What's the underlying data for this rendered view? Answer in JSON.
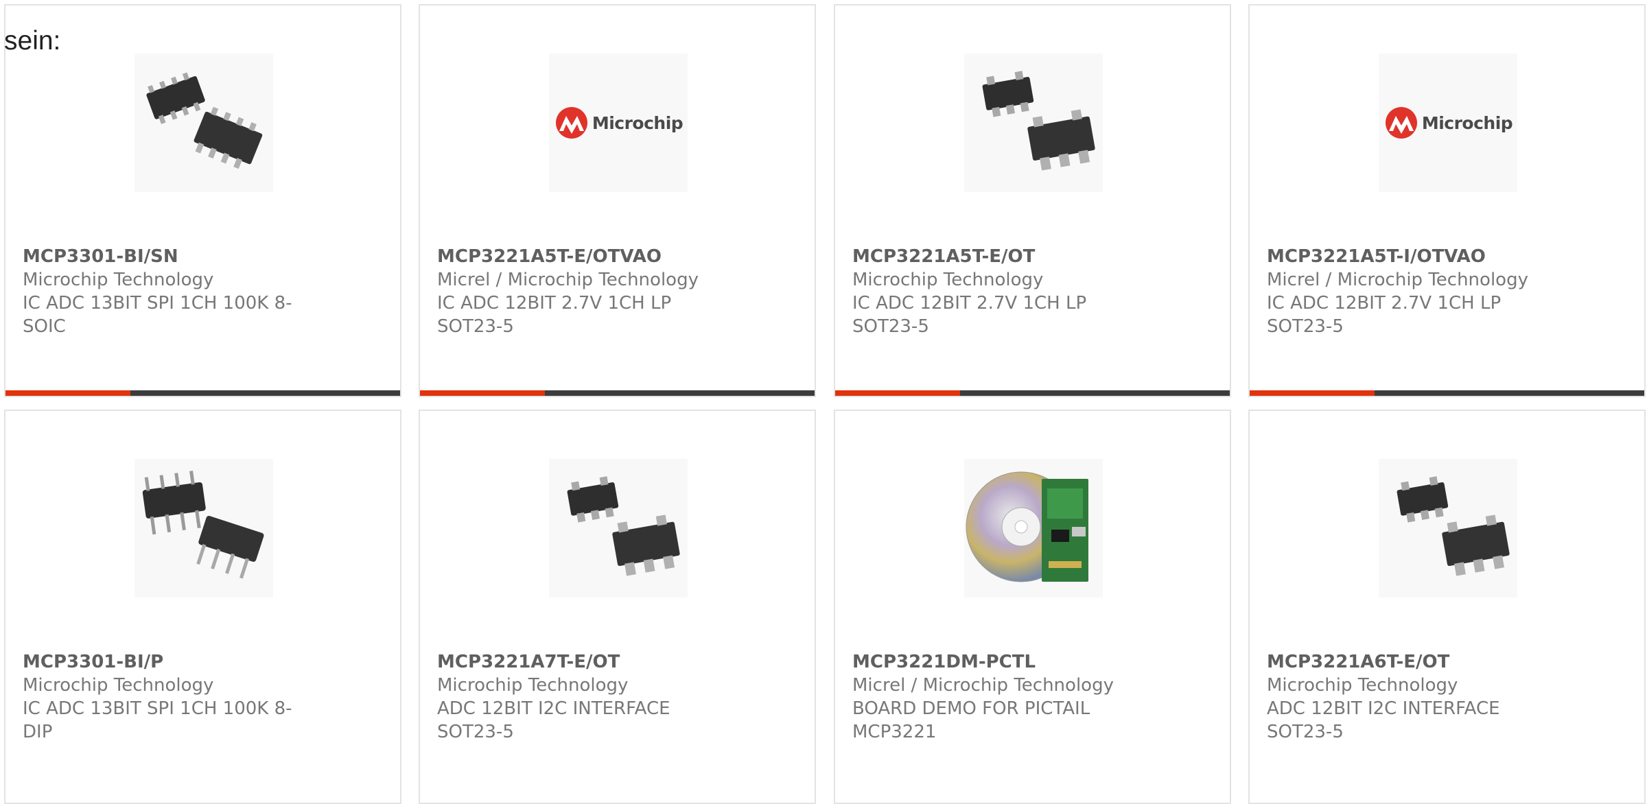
{
  "intro_text": "sein:",
  "products": [
    {
      "part_number": "MCP3301-BI/SN",
      "manufacturer": "Microchip Technology",
      "description": "IC ADC 13BIT SPI 1CH 100K 8-SOIC",
      "image": "soic-8-chip-pair"
    },
    {
      "part_number": "MCP3221A5T-E/OTVAO",
      "manufacturer": "Micrel / Microchip Technology",
      "description": "IC ADC 12BIT 2.7V 1CH LP SOT23-5",
      "image": "microchip-logo",
      "logo_text": "Microchip"
    },
    {
      "part_number": "MCP3221A5T-E/OT",
      "manufacturer": "Microchip Technology",
      "description": "IC ADC 12BIT 2.7V 1CH LP SOT23-5",
      "image": "sot23-5-chip-pair"
    },
    {
      "part_number": "MCP3221A5T-I/OTVAO",
      "manufacturer": "Micrel / Microchip Technology",
      "description": "IC ADC 12BIT 2.7V 1CH LP SOT23-5",
      "image": "microchip-logo",
      "logo_text": "Microchip"
    },
    {
      "part_number": "MCP3301-BI/P",
      "manufacturer": "Microchip Technology",
      "description": "IC ADC 13BIT SPI 1CH 100K 8-DIP",
      "image": "dip-8-chip-pair"
    },
    {
      "part_number": "MCP3221A7T-E/OT",
      "manufacturer": "Microchip Technology",
      "description": "ADC 12BIT I2C INTERFACE SOT23-5",
      "image": "sot23-5-chip-pair"
    },
    {
      "part_number": "MCP3221DM-PCTL",
      "manufacturer": "Micrel / Microchip Technology",
      "description": "BOARD DEMO FOR PICTAIL MCP3221",
      "image": "demo-board-and-cd"
    },
    {
      "part_number": "MCP3221A6T-E/OT",
      "manufacturer": "Microchip Technology",
      "description": "ADC 12BIT I2C INTERFACE SOT23-5",
      "image": "sot23-5-chip-pair"
    }
  ],
  "colors": {
    "accent": "#e0330e",
    "bar_dark": "#3c3c3c",
    "logo_red": "#e0332a",
    "card_border": "#e3e3e3"
  }
}
